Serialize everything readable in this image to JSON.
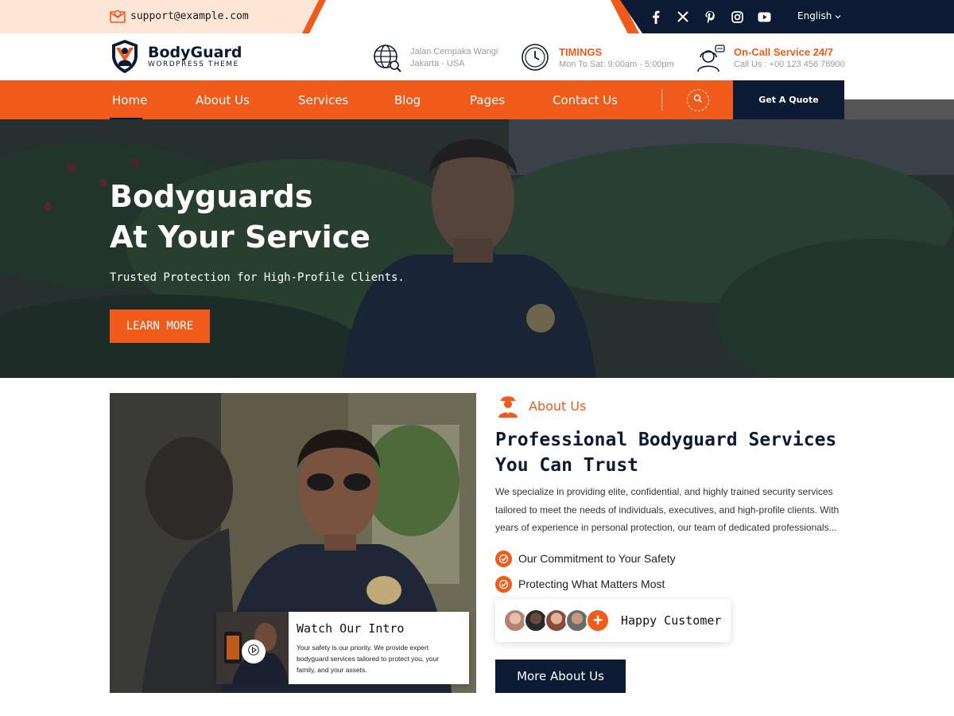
{
  "topbar": {
    "email": "support@example.com",
    "language": "English",
    "socials": [
      "facebook-icon",
      "x-icon",
      "pinterest-icon",
      "instagram-icon",
      "youtube-icon"
    ]
  },
  "brand": {
    "name": "BodyGuard",
    "tagline": "WORDPRESS THEME"
  },
  "header_info": {
    "address": {
      "line1": "Jalan Cempaka Wangi",
      "line2": "Jakarta - USA"
    },
    "timings": {
      "title": "TIMINGS",
      "line": "Mon To Sat: 9:00am - 5:00pm"
    },
    "service": {
      "title": "On-Call Service 24/7",
      "line": "Call Us : +00 123 456 78900"
    }
  },
  "nav": {
    "items": [
      "Home",
      "About Us",
      "Services",
      "Blog",
      "Pages",
      "Contact Us"
    ],
    "active": "Home",
    "quote_label": "Get A Quote"
  },
  "hero": {
    "title_line1": "Bodyguards",
    "title_line2": "At Your Service",
    "subtitle": "Trusted Protection for High-Profile Clients.",
    "button": "LEARN MORE"
  },
  "intro": {
    "title": "Watch Our Intro",
    "desc": "Your safety is our priority. We provide expert bodyguard services tailored to protect you, your family, and your assets."
  },
  "about": {
    "tag": "About Us",
    "heading": "Professional Bodyguard Services You Can Trust",
    "paragraph": "We specialize in providing elite, confidential, and highly trained security services tailored to meet the needs of individuals, executives, and high-profile clients. With years of experience in personal protection, our team of dedicated professionals...",
    "checks": [
      "Our Commitment to Your Safety",
      "Protecting What Matters Most"
    ],
    "happy_label": "Happy Customer",
    "more_button": "More About Us"
  },
  "colors": {
    "accent": "#f05a1a",
    "navy": "#0d1a33"
  }
}
